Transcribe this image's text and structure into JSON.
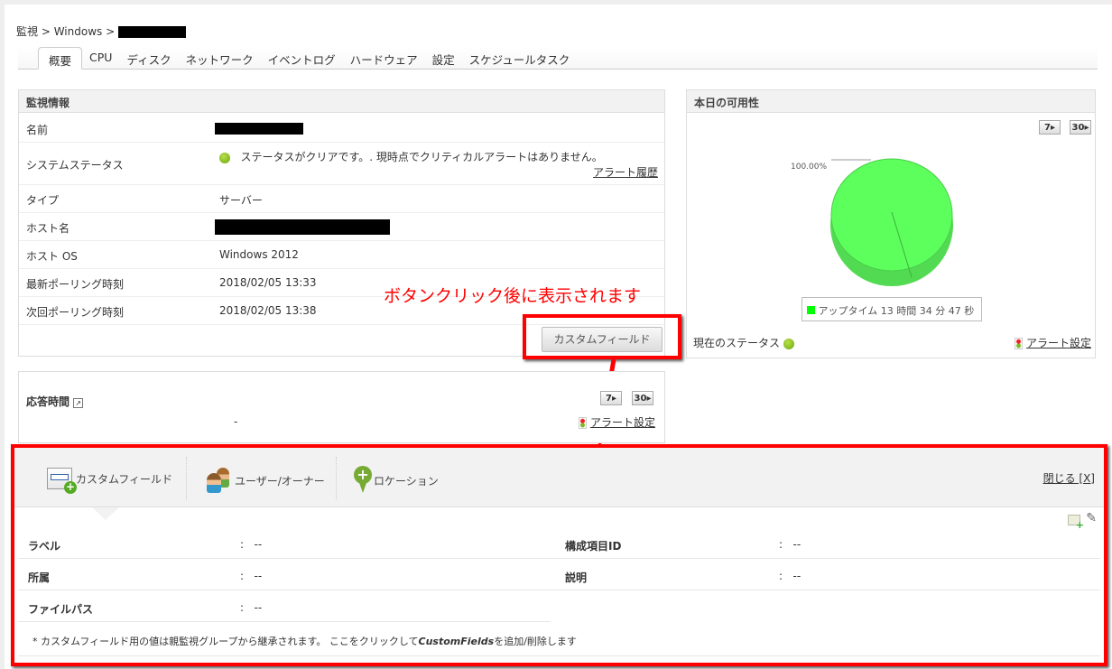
{
  "breadcrumb": {
    "root": "監視",
    "sep": " > ",
    "section": "Windows"
  },
  "tabs": [
    "概要",
    "CPU",
    "ディスク",
    "ネットワーク",
    "イベントログ",
    "ハードウェア",
    "設定",
    "スケジュールタスク"
  ],
  "monitor_info": {
    "title": "監視情報",
    "rows": [
      {
        "label": "名前",
        "value": ""
      },
      {
        "label": "システムステータス",
        "value": "ステータスがクリアです。. 現時点でクリティカルアラートはありません。",
        "link": "アラート履歴"
      },
      {
        "label": "タイプ",
        "value": "サーバー"
      },
      {
        "label": "ホスト名",
        "value": ""
      },
      {
        "label": "ホスト OS",
        "value": "Windows 2012"
      },
      {
        "label": "最新ポーリング時刻",
        "value": "2018/02/05 13:33"
      },
      {
        "label": "次回ポーリング時刻",
        "value": "2018/02/05 13:38"
      }
    ],
    "custom_field_button": "カスタムフィールド"
  },
  "annotation": "ボタンクリック後に表示されます",
  "availability": {
    "title": "本日の可用性",
    "btn7": "7",
    "btn30": "30",
    "pie_label": "100.00%",
    "legend": "アップタイム 13 時間 34 分 47 秒",
    "current_status": "現在のステータス",
    "alert_settings": "アラート設定",
    "colors": {
      "uptime": "#5cff5c"
    }
  },
  "chart_data": {
    "type": "pie",
    "categories": [
      "アップタイム"
    ],
    "values": [
      100.0
    ],
    "data_labels": [
      "100.00%"
    ]
  },
  "response": {
    "title": "応答時間",
    "value": "-",
    "btn7": "7",
    "btn30": "30",
    "alert_settings": "アラート設定"
  },
  "custom_panel": {
    "tabs": [
      "カスタムフィールド",
      "ユーザー/オーナー",
      "ロケーション"
    ],
    "close": "閉じる [X]",
    "fields": [
      {
        "label": "ラベル",
        "value": "--"
      },
      {
        "label": "構成項目ID",
        "value": "--"
      },
      {
        "label": "所属",
        "value": "--"
      },
      {
        "label": "説明",
        "value": "--"
      },
      {
        "label": "ファイルパス",
        "value": "--"
      }
    ],
    "sep": ":",
    "note_prefix": "* カスタムフィールド用の値は親監視グループから継承されます。 ここをクリックして",
    "note_em": "CustomFields",
    "note_suffix": "を追加/削除します"
  }
}
